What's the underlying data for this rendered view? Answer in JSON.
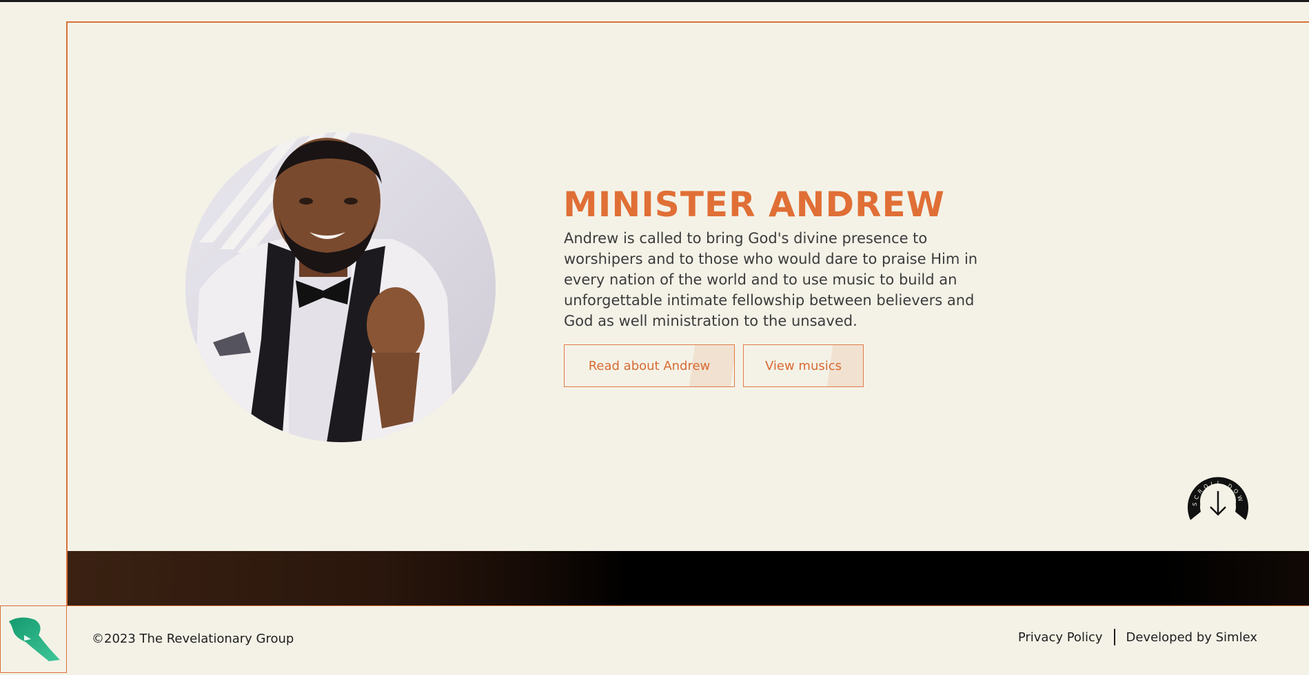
{
  "hero": {
    "title": "MINISTER ANDREW",
    "description": "Andrew is called to bring God's divine presence to worshipers and to those who would dare to praise Him in every nation of the world and to use music to build an unforgettable intimate fellowship between believers and God as well ministration to the unsaved.",
    "buttons": {
      "read_about": "Read about Andrew",
      "view_musics": "View musics"
    },
    "scroll_label": "SCROLL DOWN"
  },
  "footer": {
    "copyright": "©2023 The Revelationary Group",
    "privacy": "Privacy Policy",
    "developer": "Developed by Simlex"
  },
  "colors": {
    "accent": "#e06f36",
    "background": "#f4f2e7",
    "dark": "#000000",
    "logo_green": "#1fa37a"
  }
}
